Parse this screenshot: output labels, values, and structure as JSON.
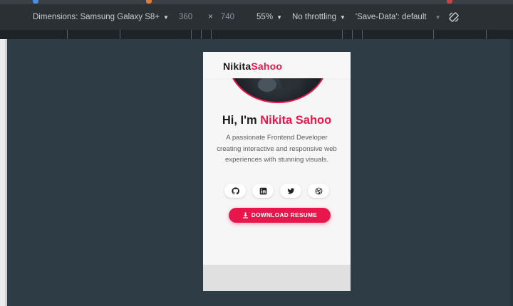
{
  "devtools": {
    "dimensions_label": "Dimensions: Samsung Galaxy S8+",
    "width_value": "360",
    "times_sign": "×",
    "height_value": "740",
    "zoom": "55%",
    "throttling": "No throttling",
    "save_data": "'Save-Data': default"
  },
  "page": {
    "brand_first": "Nikita",
    "brand_last": "Sahoo",
    "greeting_prefix": "Hi, I'm ",
    "greeting_name": "Nikita Sahoo",
    "description": "A passionate Frontend Developer creating interactive and responsive web experiences with stunning visuals.",
    "socials": [
      {
        "icon": "github-icon"
      },
      {
        "icon": "linkedin-icon"
      },
      {
        "icon": "twitter-icon"
      },
      {
        "icon": "dribbble-icon"
      }
    ],
    "download_label": "DOWNLOAD RESUME"
  },
  "colors": {
    "accent": "#e8174b",
    "toolbar_bg": "#2b3035",
    "workspace_bg": "#2e3d45",
    "page_bg": "#f6f6f6"
  }
}
